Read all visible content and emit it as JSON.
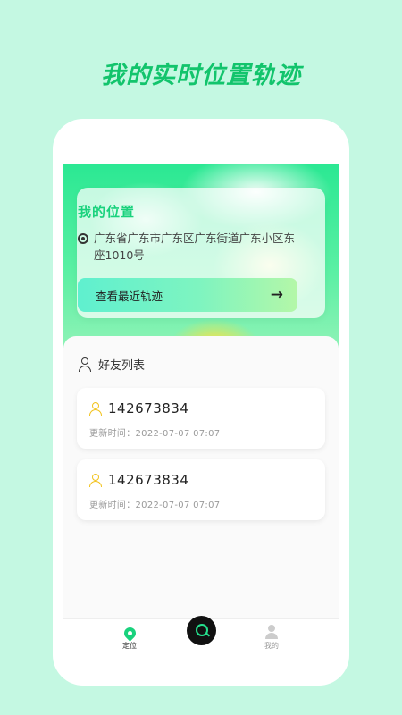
{
  "promo": {
    "title": "我的实时位置轨迹"
  },
  "location_card": {
    "title": "我的位置",
    "address": "广东省广东市广东区广东街道广东小区东座1010号",
    "button_label": "查看最近轨迹",
    "arrow": "→"
  },
  "friends": {
    "title": "好友列表",
    "items": [
      {
        "id": "142673834",
        "update_time": "更新时间：2022-07-07 07:07"
      },
      {
        "id": "142673834",
        "update_time": "更新时间：2022-07-07 07:07"
      }
    ]
  },
  "tabbar": {
    "items": [
      {
        "label": "定位",
        "icon": "location-pin-icon",
        "active": true
      },
      {
        "label": "",
        "icon": "search-icon",
        "active": false
      },
      {
        "label": "我的",
        "icon": "user-icon",
        "active": false
      }
    ]
  },
  "colors": {
    "background": "#c4f8e2",
    "accent_green": "#19d27d",
    "user_icon_yellow": "#f2c21a",
    "center_button": "#111111"
  }
}
